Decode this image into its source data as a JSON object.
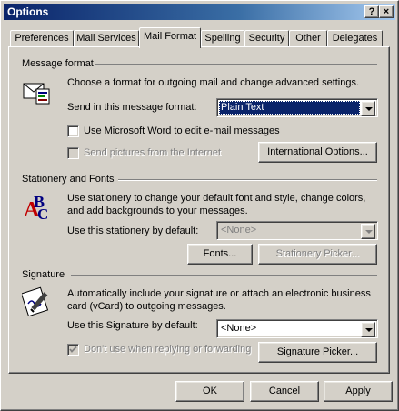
{
  "window": {
    "title": "Options",
    "help_button": "?",
    "close_button": "×"
  },
  "tabs": [
    {
      "label": "Preferences",
      "active": false
    },
    {
      "label": "Mail Services",
      "active": false
    },
    {
      "label": "Mail Format",
      "active": true
    },
    {
      "label": "Spelling",
      "active": false
    },
    {
      "label": "Security",
      "active": false
    },
    {
      "label": "Other",
      "active": false
    },
    {
      "label": "Delegates",
      "active": false
    }
  ],
  "message_format": {
    "heading": "Message format",
    "description": "Choose a format for outgoing mail and change advanced settings.",
    "send_label": "Send in this message format:",
    "format_value": "Plain Text",
    "use_word_label": "Use Microsoft Word to edit e-mail messages",
    "use_word_checked": false,
    "send_pictures_label": "Send pictures from the Internet",
    "send_pictures_checked": false,
    "international_button": "International Options..."
  },
  "stationery": {
    "heading": "Stationery and Fonts",
    "description": "Use stationery to change your default font and style, change colors, and add backgrounds to your messages.",
    "use_label": "Use this stationery by default:",
    "stationery_value": "<None>",
    "fonts_button": "Fonts...",
    "picker_button": "Stationery Picker..."
  },
  "signature": {
    "heading": "Signature",
    "description": "Automatically include your signature or attach an electronic business card (vCard) to outgoing messages.",
    "use_label": "Use this Signature by default:",
    "signature_value": "<None>",
    "dont_use_label": "Don't use when replying or forwarding",
    "dont_use_checked": true,
    "picker_button": "Signature Picker..."
  },
  "footer": {
    "ok": "OK",
    "cancel": "Cancel",
    "apply": "Apply"
  }
}
